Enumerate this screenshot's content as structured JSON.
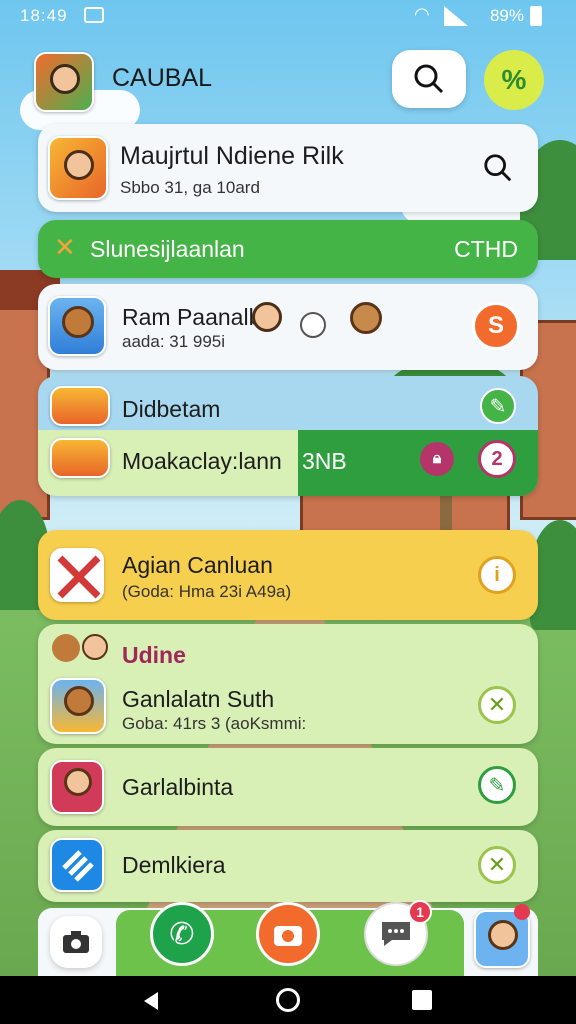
{
  "status_bar": {
    "time": "18:49",
    "battery": "89%"
  },
  "header": {
    "app_title": "CAUBAL"
  },
  "search_card": {
    "title": "Maujrtul Ndiene Rilk",
    "subtitle": "Sbbo 31, ga 10ard"
  },
  "green_bar": {
    "label": "Slunesijlaanlan",
    "right_label": "CTHD"
  },
  "item1": {
    "title": "Ram Paanalb",
    "subtitle": "aada: 31 995i"
  },
  "item2": {
    "title": "Didbetam"
  },
  "item3": {
    "title": "Moakaclay:lann",
    "badge": "3NB"
  },
  "item4": {
    "title": "Agian Canluan",
    "subtitle": "(Goda: Hma 23i A49a)"
  },
  "section": {
    "title": "Udine"
  },
  "item5": {
    "title": "Ganlalatn Suth",
    "subtitle": "Goba: 41rs 3 (aoKsmmi:"
  },
  "item6": {
    "title": "Garlalbinta"
  },
  "item7": {
    "title": "Demlkiera"
  },
  "dock": {
    "message_badge": "1"
  },
  "colors": {
    "green": "#45b446",
    "yellow": "#f7cf4e",
    "light_green": "#d8efb6",
    "orange": "#f26b2d"
  }
}
